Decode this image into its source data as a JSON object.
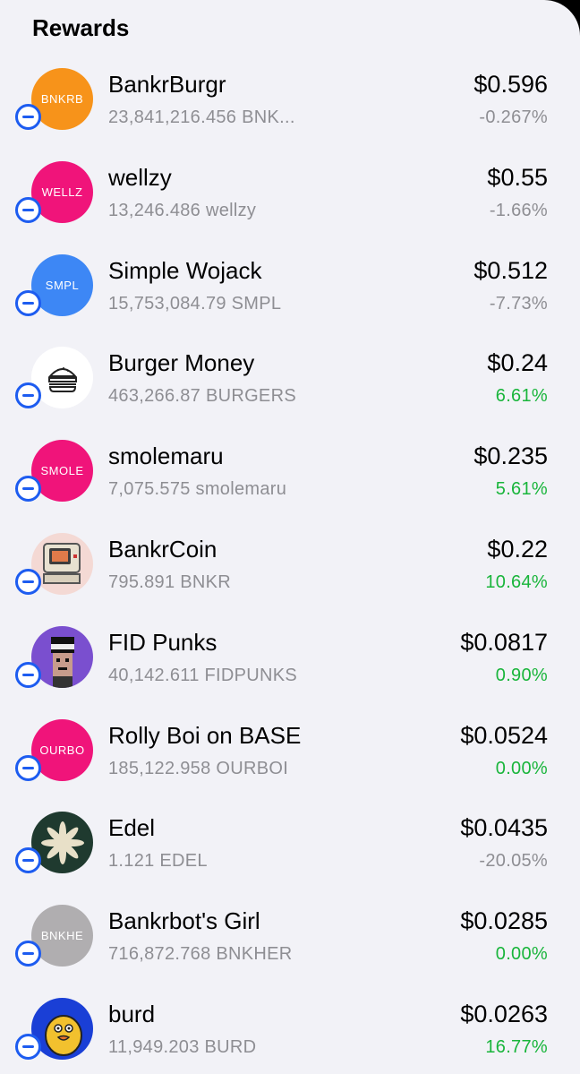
{
  "header": {
    "title": "Rewards"
  },
  "tokens": [
    {
      "avatar_text": "BNKRB",
      "avatar_color": "#f7931a",
      "name": "BankrBurgr",
      "amount": "23,841,216.456 BNK...",
      "price": "$0.596",
      "change": "-0.267%",
      "direction": "neg"
    },
    {
      "avatar_text": "WELLZ",
      "avatar_color": "#f0147a",
      "name": "wellzy",
      "amount": "13,246.486 wellzy",
      "price": "$0.55",
      "change": "-1.66%",
      "direction": "neg"
    },
    {
      "avatar_text": "SMPL",
      "avatar_color": "#3d87f5",
      "name": "Simple Wojack",
      "amount": "15,753,084.79 SMPL",
      "price": "$0.512",
      "change": "-7.73%",
      "direction": "neg"
    },
    {
      "avatar_icon": "burger-icon",
      "avatar_color": "#ffffff",
      "name": "Burger Money",
      "amount": "463,266.87 BURGERS",
      "price": "$0.24",
      "change": "6.61%",
      "direction": "pos"
    },
    {
      "avatar_text": "SMOLE",
      "avatar_color": "#f0147a",
      "name": "smolemaru",
      "amount": "7,075.575 smolemaru",
      "price": "$0.235",
      "change": "5.61%",
      "direction": "pos"
    },
    {
      "avatar_icon": "retro-computer-icon",
      "avatar_color": "#f4d9d4",
      "name": "BankrCoin",
      "amount": "795.891 BNKR",
      "price": "$0.22",
      "change": "10.64%",
      "direction": "pos"
    },
    {
      "avatar_icon": "pixel-punk-icon",
      "avatar_color": "#7a4fcf",
      "name": "FID Punks",
      "amount": "40,142.611 FIDPUNKS",
      "price": "$0.0817",
      "change": "0.90%",
      "direction": "pos"
    },
    {
      "avatar_text": "OURBO",
      "avatar_color": "#f0147a",
      "name": "Rolly Boi on BASE",
      "amount": "185,122.958 OURBOI",
      "price": "$0.0524",
      "change": "0.00%",
      "direction": "pos"
    },
    {
      "avatar_icon": "leaf-flower-icon",
      "avatar_color": "#1f3a2f",
      "name": "Edel",
      "amount": "1.121 EDEL",
      "price": "$0.0435",
      "change": "-20.05%",
      "direction": "neg"
    },
    {
      "avatar_text": "BNKHE",
      "avatar_color": "#b0aeb0",
      "name": "Bankrbot's Girl",
      "amount": "716,872.768 BNKHER",
      "price": "$0.0285",
      "change": "0.00%",
      "direction": "pos"
    },
    {
      "avatar_icon": "yellow-bird-icon",
      "avatar_color": "#1a3fd6",
      "name": "burd",
      "amount": "11,949.203 BURD",
      "price": "$0.0263",
      "change": "16.77%",
      "direction": "pos"
    }
  ]
}
